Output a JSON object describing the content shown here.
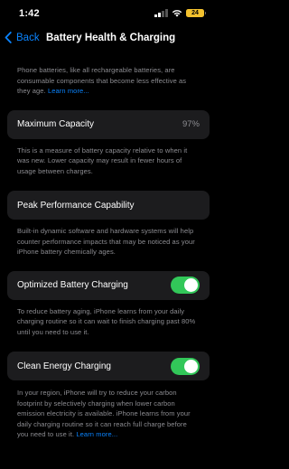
{
  "status_bar": {
    "time": "1:42",
    "battery_level": "24",
    "battery_color": "#f3c12e"
  },
  "nav": {
    "back_label": "Back",
    "title": "Battery Health & Charging"
  },
  "intro": {
    "text": "Phone batteries, like all rechargeable batteries, are consumable components that become less effective as they age. ",
    "link": "Learn more..."
  },
  "maximum_capacity": {
    "label": "Maximum Capacity",
    "value": "97%",
    "description": "This is a measure of battery capacity relative to when it was new. Lower capacity may result in fewer hours of usage between charges."
  },
  "peak_performance": {
    "label": "Peak Performance Capability",
    "description": "Built-in dynamic software and hardware systems will help counter performance impacts that may be noticed as your iPhone battery chemically ages."
  },
  "optimized_charging": {
    "label": "Optimized Battery Charging",
    "enabled": true,
    "description": "To reduce battery aging, iPhone learns from your daily charging routine so it can wait to finish charging past 80% until you need to use it."
  },
  "clean_energy": {
    "label": "Clean Energy Charging",
    "enabled": true,
    "description": "In your region, iPhone will try to reduce your carbon footprint by selectively charging when lower carbon emission electricity is available. iPhone learns from your daily charging routine so it can reach full charge before you need to use it. ",
    "link": "Learn more..."
  },
  "colors": {
    "accent": "#0a84ff",
    "toggle_on": "#32c759",
    "cell_bg": "#1c1c1e",
    "secondary_text": "#8d8d92"
  }
}
